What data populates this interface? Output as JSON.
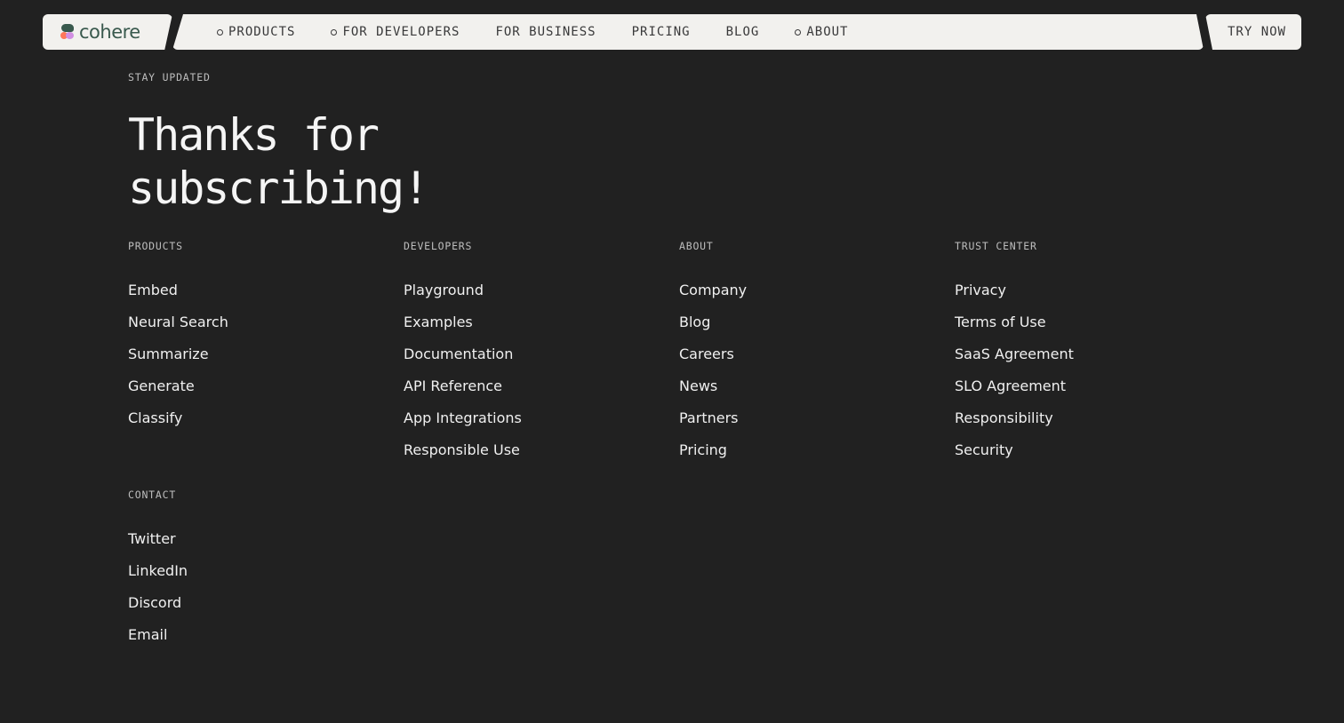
{
  "nav": {
    "logo_text": "cohere",
    "items": [
      {
        "label": "PRODUCTS",
        "has_dot": true
      },
      {
        "label": "FOR DEVELOPERS",
        "has_dot": true
      },
      {
        "label": "FOR BUSINESS",
        "has_dot": false
      },
      {
        "label": "PRICING",
        "has_dot": false
      },
      {
        "label": "BLOG",
        "has_dot": false
      },
      {
        "label": "ABOUT",
        "has_dot": true
      }
    ],
    "cta_label": "TRY NOW"
  },
  "hero": {
    "eyebrow": "STAY UPDATED",
    "headline_line1": "Thanks for",
    "headline_line2": "subscribing!"
  },
  "footer": {
    "columns": [
      {
        "title": "PRODUCTS",
        "links": [
          "Embed",
          "Neural Search",
          "Summarize",
          "Generate",
          "Classify"
        ]
      },
      {
        "title": "DEVELOPERS",
        "links": [
          "Playground",
          "Examples",
          "Documentation",
          "API Reference",
          "App Integrations",
          "Responsible Use"
        ]
      },
      {
        "title": "ABOUT",
        "links": [
          "Company",
          "Blog",
          "Careers",
          "News",
          "Partners",
          "Pricing"
        ]
      },
      {
        "title": "TRUST CENTER",
        "links": [
          "Privacy",
          "Terms of Use",
          "SaaS Agreement",
          "SLO Agreement",
          "Responsibility",
          "Security"
        ]
      },
      {
        "title": "CONTACT",
        "links": [
          "Twitter",
          "LinkedIn",
          "Discord",
          "Email"
        ]
      }
    ]
  },
  "colors": {
    "background": "#212121",
    "nav_background": "#f2f1ee",
    "brand_green": "#39594d",
    "brand_coral": "#ff7759",
    "brand_lilac": "#d18ee2"
  },
  "icons": {
    "logo": "cohere-logo-mark",
    "nav_dot": "circle-outline-icon"
  }
}
